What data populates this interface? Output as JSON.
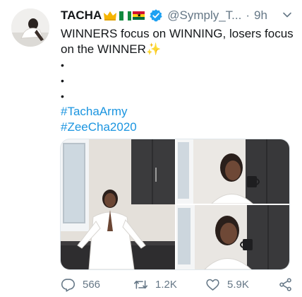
{
  "tweet": {
    "author_name": "TACHA",
    "handle": "@Symply_T...",
    "separator": "·",
    "time": "9h",
    "text_line1": "WINNERS focus on WINNING, losers focus",
    "text_line2": "on the WINNER",
    "sparkle": "✨",
    "bullets": [
      "•",
      "•",
      "•"
    ],
    "hashtags": [
      "#TachaArmy",
      "#ZeeCha2020"
    ]
  },
  "stats": {
    "replies": "566",
    "retweets": "1.2K",
    "likes": "5.9K"
  },
  "icons": {
    "avatar": "profile-photo",
    "crown": "crown-icon",
    "flags": [
      "nigeria-flag",
      "ghana-flag"
    ],
    "verified": "verified-badge-icon",
    "menu": "chevron-down-icon",
    "reply": "reply-icon",
    "retweet": "retweet-icon",
    "like": "heart-icon",
    "share": "share-icon"
  },
  "colors": {
    "accent": "#1b95e0",
    "secondary_text": "#657786",
    "primary_text": "#14171a"
  }
}
